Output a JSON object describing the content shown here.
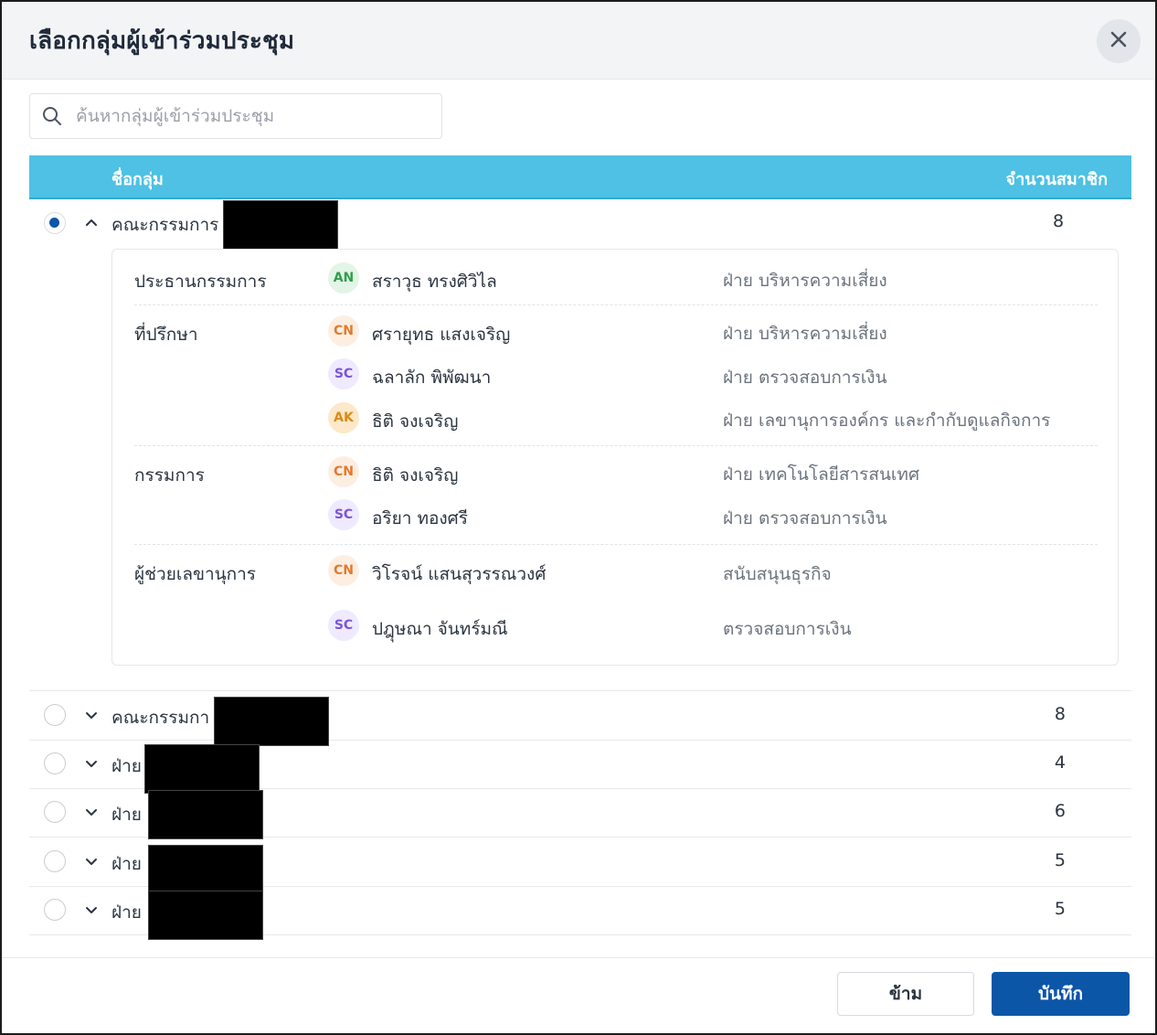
{
  "dialog": {
    "title": "เลือกกลุ่มผู้เข้าร่วมประชุม"
  },
  "search": {
    "placeholder": "ค้นหากลุ่มผู้เข้าร่วมประชุม",
    "value": ""
  },
  "table": {
    "col_name": "ชื่อกลุ่ม",
    "col_count": "จำนวนสมาชิก"
  },
  "groups": [
    {
      "name": "คณะกรรมการ",
      "count": "8",
      "selected": true,
      "expanded": true,
      "roles": [
        {
          "role": "ประธานกรรมการ",
          "members": [
            {
              "initials": "AN",
              "name": "สราวุธ ทรงศิวิไล",
              "dept": "ฝ่าย บริหารความเสี่ยง"
            }
          ]
        },
        {
          "role": "ที่ปรึกษา",
          "members": [
            {
              "initials": "CN",
              "name": "ศรายุทธ แสงเจริญ",
              "dept": "ฝ่าย บริหารความเสี่ยง"
            },
            {
              "initials": "SC",
              "name": "ฉลาลัก พิพัฒนา",
              "dept": "ฝ่าย ตรวจสอบการเงิน"
            },
            {
              "initials": "AK",
              "name": "ธิติ จงเจริญ",
              "dept": "ฝ่าย  เลขานุการองค์กร และกำกับดูแลกิจการ"
            }
          ]
        },
        {
          "role": "กรรมการ",
          "members": [
            {
              "initials": "CN",
              "name": "ธิติ จงเจริญ",
              "dept": "ฝ่าย เทคโนโลยีสารสนเทศ"
            },
            {
              "initials": "SC",
              "name": "อริยา ทองศรี",
              "dept": "ฝ่าย ตรวจสอบการเงิน"
            }
          ]
        },
        {
          "role": "ผู้ช่วยเลขานุการ",
          "members": [
            {
              "initials": "CN",
              "name": "วิโรจน์ แสนสุวรรณวงศ์",
              "dept": "สนับสนุนธุรกิจ"
            },
            {
              "initials": "SC",
              "name": "ปฎุษณา จันทร์มณี",
              "dept": "ตรวจสอบการเงิน"
            }
          ]
        }
      ]
    },
    {
      "name": "คณะกรรมกา",
      "count": "8",
      "selected": false,
      "expanded": false
    },
    {
      "name": "ฝ่าย",
      "count": "4",
      "selected": false,
      "expanded": false
    },
    {
      "name": "ฝ่าย",
      "count": "6",
      "selected": false,
      "expanded": false
    },
    {
      "name": "ฝ่าย",
      "count": "5",
      "selected": false,
      "expanded": false
    },
    {
      "name": "ฝ่าย",
      "count": "5",
      "selected": false,
      "expanded": false
    }
  ],
  "footer": {
    "skip_label": "ข้าม",
    "save_label": "บันทึก"
  },
  "colors": {
    "primary": "#0c56a8",
    "table_header": "#4ec1e4"
  }
}
